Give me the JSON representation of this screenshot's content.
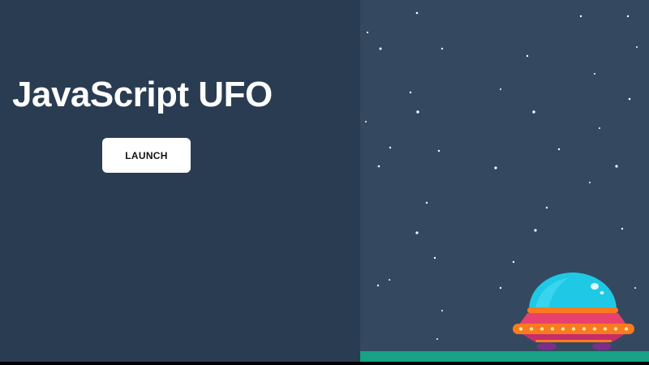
{
  "app": {
    "title": "JavaScript UFO",
    "launch_label": "LAUNCH"
  },
  "colors": {
    "left_background": "#2a3c52",
    "stage_background": "#34495f",
    "ground": "#17a185",
    "button_background": "#ffffff",
    "ufo_dome": "#1fc9e6",
    "ufo_body": "#e8416f",
    "ufo_band": "#f97b1e",
    "ufo_lights": "#ffe7a8",
    "ufo_legs": "#7a2f8a"
  },
  "icons": {
    "ufo": "ufo-spaceship",
    "stars": "starfield"
  }
}
